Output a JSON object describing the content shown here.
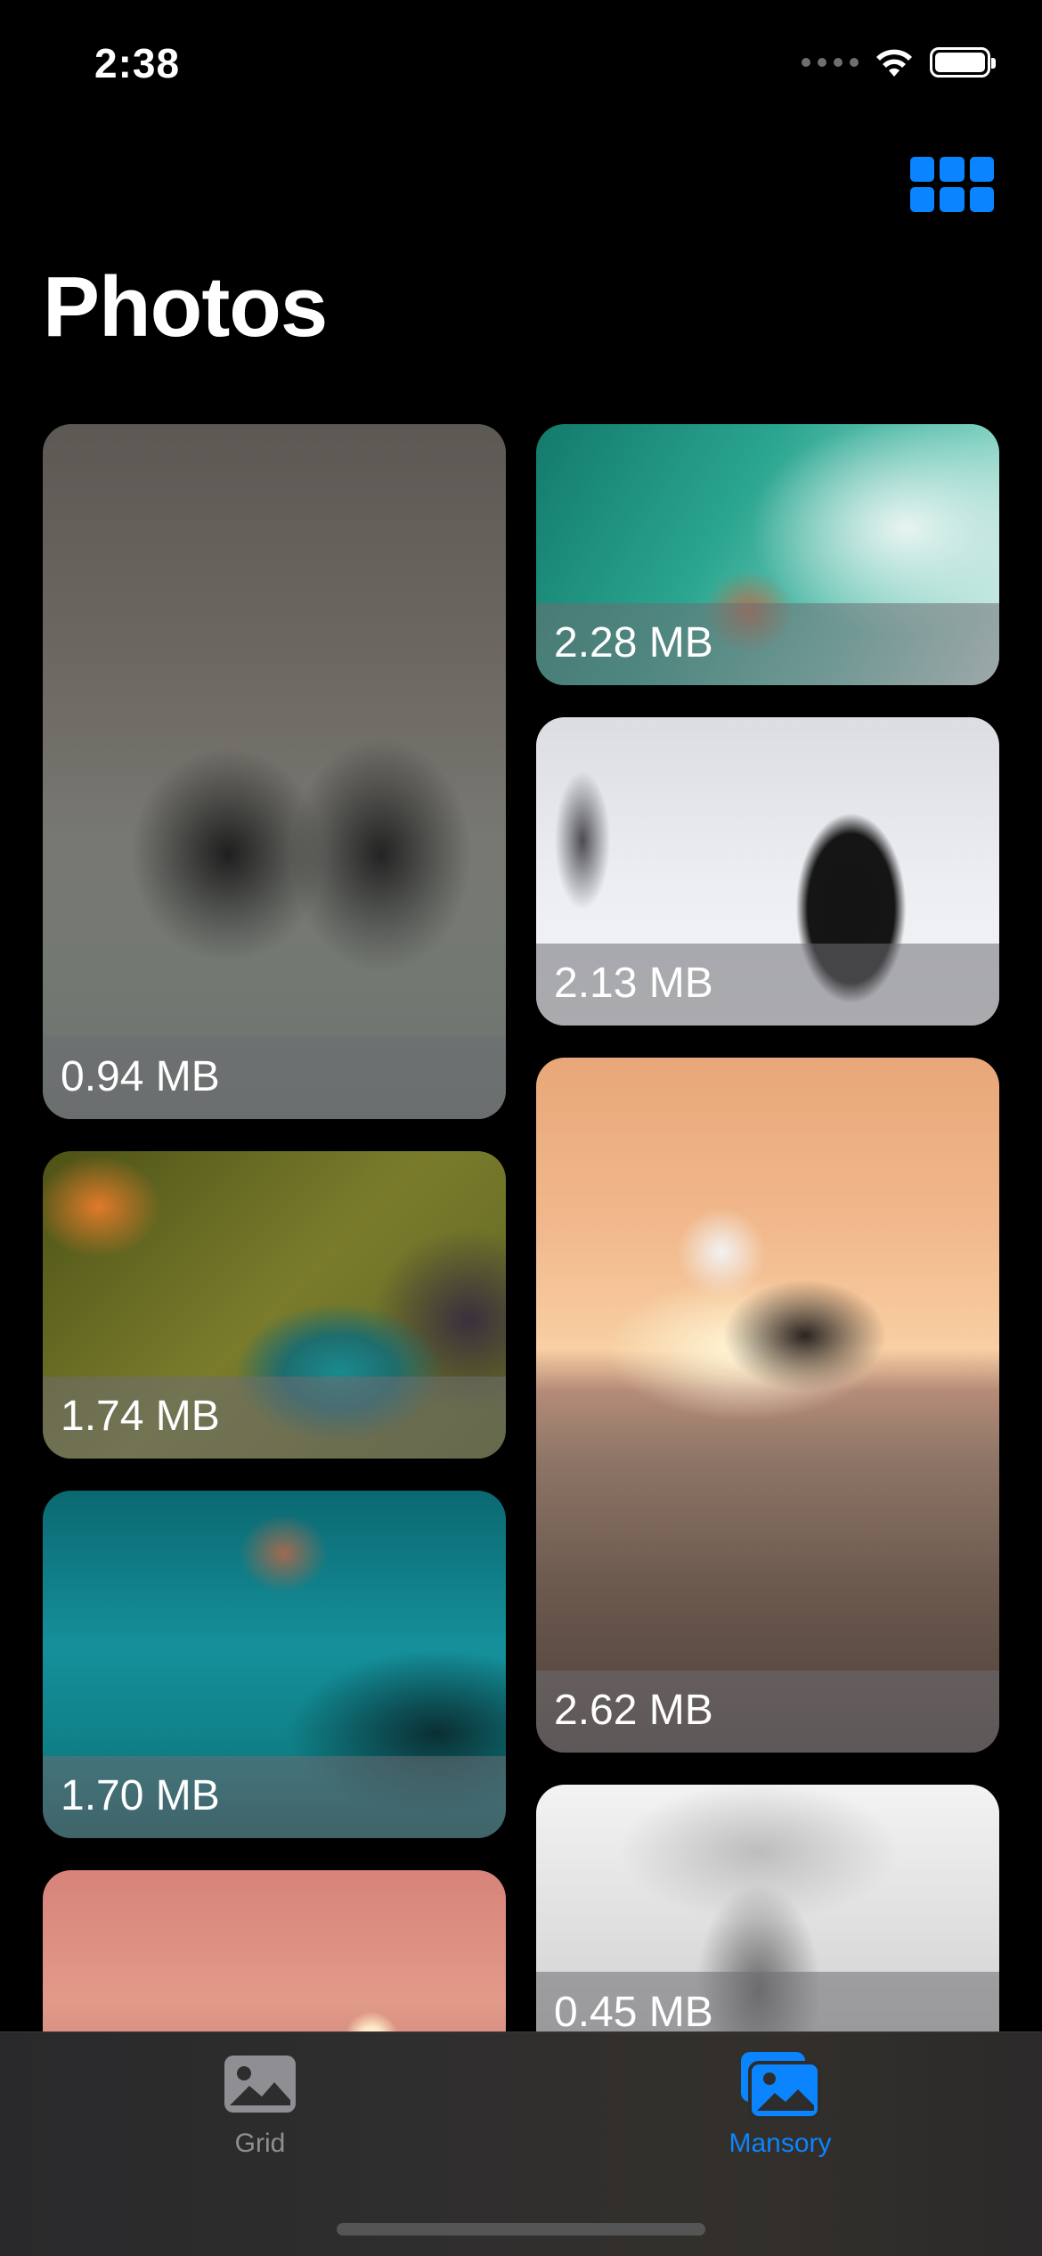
{
  "status_bar": {
    "time": "2:38"
  },
  "header": {
    "title": "Photos",
    "layout_toggle_icon": "grid-icon"
  },
  "photos": {
    "left": [
      {
        "size": "0.94 MB",
        "subject": "street-cyclists"
      },
      {
        "size": "1.74 MB",
        "subject": "hummingbird"
      },
      {
        "size": "1.70 MB",
        "subject": "diver"
      },
      {
        "size": "",
        "subject": "sunset"
      }
    ],
    "right": [
      {
        "size": "2.28 MB",
        "subject": "surfer"
      },
      {
        "size": "2.13 MB",
        "subject": "running-dog"
      },
      {
        "size": "2.62 MB",
        "subject": "skateboarder"
      },
      {
        "size": "0.45 MB",
        "subject": "jumping-man"
      }
    ]
  },
  "tab_bar": {
    "tabs": [
      {
        "label": "Grid",
        "icon": "photo-icon",
        "active": false
      },
      {
        "label": "Mansory",
        "icon": "photo-stack-icon",
        "active": true
      }
    ],
    "active_color": "#0a84ff",
    "inactive_color": "#8e8e93"
  }
}
